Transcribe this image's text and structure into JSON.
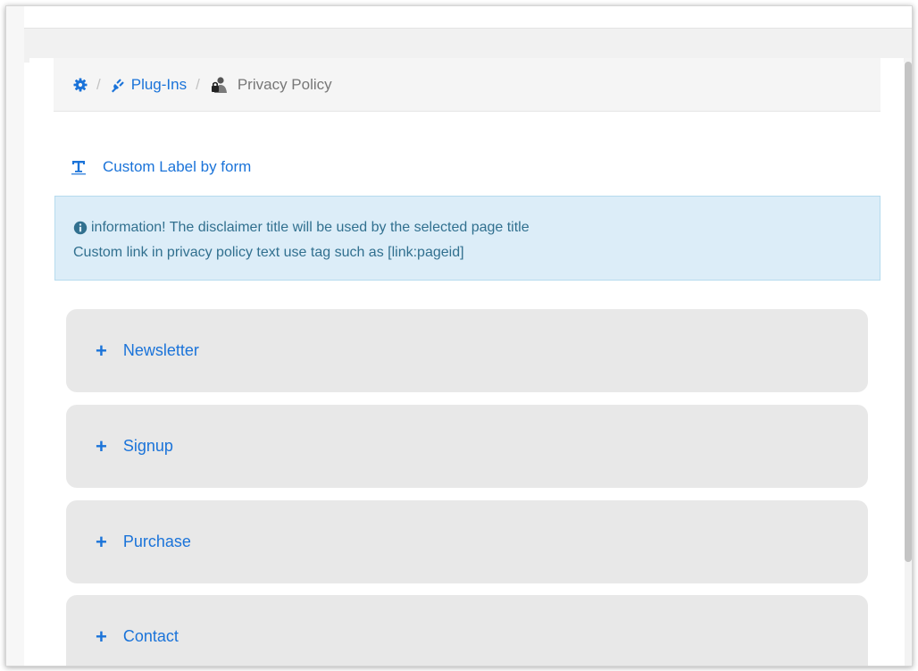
{
  "breadcrumb": {
    "home_icon": "gear-icon",
    "plugins_label": "Plug-Ins",
    "plugins_icon": "plug-icon",
    "separator": "/",
    "current_label": "Privacy Policy",
    "current_icon": "privacy-user-lock-icon"
  },
  "section": {
    "title": "Custom Label by form",
    "icon": "text-type-icon"
  },
  "alert": {
    "icon": "info-circle-icon",
    "line1": "information! The disclaimer title will be used by the selected page title",
    "line2": "Custom link in privacy policy text use tag such as [link:pageid]"
  },
  "accordion": {
    "expand_symbol": "+",
    "items": [
      {
        "label": "Newsletter"
      },
      {
        "label": "Signup"
      },
      {
        "label": "Purchase"
      },
      {
        "label": "Contact"
      }
    ]
  },
  "colors": {
    "link": "#1a73d9",
    "alert_bg": "#dcedf8",
    "alert_text": "#31708f",
    "panel_bg": "#e8e8e8"
  }
}
